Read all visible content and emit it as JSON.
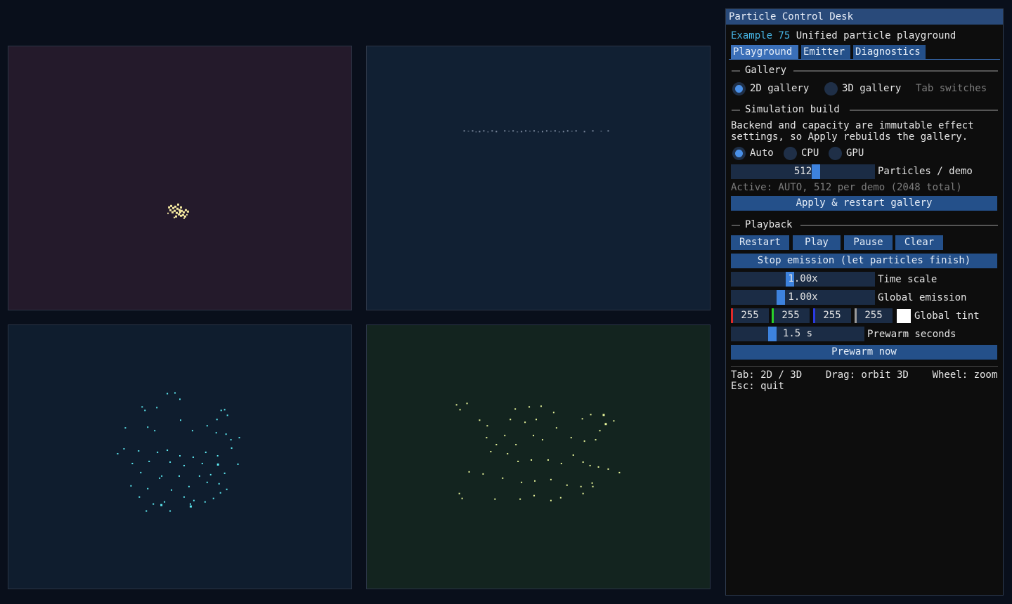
{
  "panel": {
    "title": "Particle Control Desk",
    "example_label": "Example 75",
    "example_desc": "Unified particle playground",
    "tabs": [
      "Playground",
      "Emitter",
      "Diagnostics"
    ],
    "gallery": {
      "header": "Gallery",
      "option_2d": "2D gallery",
      "option_3d": "3D gallery",
      "hint": "Tab switches",
      "selected": "2D gallery"
    },
    "simulation": {
      "header": "Simulation build",
      "note_line1": "Backend and capacity are immutable effect",
      "note_line2": "settings, so Apply rebuilds the gallery.",
      "backend_auto": "Auto",
      "backend_cpu": "CPU",
      "backend_gpu": "GPU",
      "backend_selected": "Auto",
      "particles_value": "512",
      "particles_label": "Particles / demo",
      "active_status": "Active: AUTO, 512 per demo (2048 total)",
      "apply_label": "Apply & restart gallery"
    },
    "playback": {
      "header": "Playback",
      "restart_label": "Restart",
      "play_label": "Play",
      "pause_label": "Pause",
      "clear_label": "Clear",
      "stop_label": "Stop emission (let particles finish)",
      "time_scale_value": "1.00x",
      "time_scale_label": "Time scale",
      "emission_value": "1.00x",
      "emission_label": "Global emission",
      "tint_r": "255",
      "tint_g": "255",
      "tint_b": "255",
      "tint_a": "255",
      "tint_label": "Global tint",
      "tint_color": "#ffffff",
      "prewarm_value": "1.5 s",
      "prewarm_label": "Prewarm seconds",
      "prewarm_now_label": "Prewarm now"
    },
    "help_line1": "Tab: 2D / 3D    Drag: orbit 3D    Wheel: zoom",
    "help_line2": "Esc: quit"
  },
  "colors": {
    "accent": "#47b6e6",
    "button": "#24508a",
    "slider_grab": "#3d82dd",
    "demo1_particles": "#f5e9a0",
    "demo2_particles": "#7d8a9f",
    "demo3_particles": "#5ce8f0",
    "demo4_particles": "#e8f59a"
  }
}
